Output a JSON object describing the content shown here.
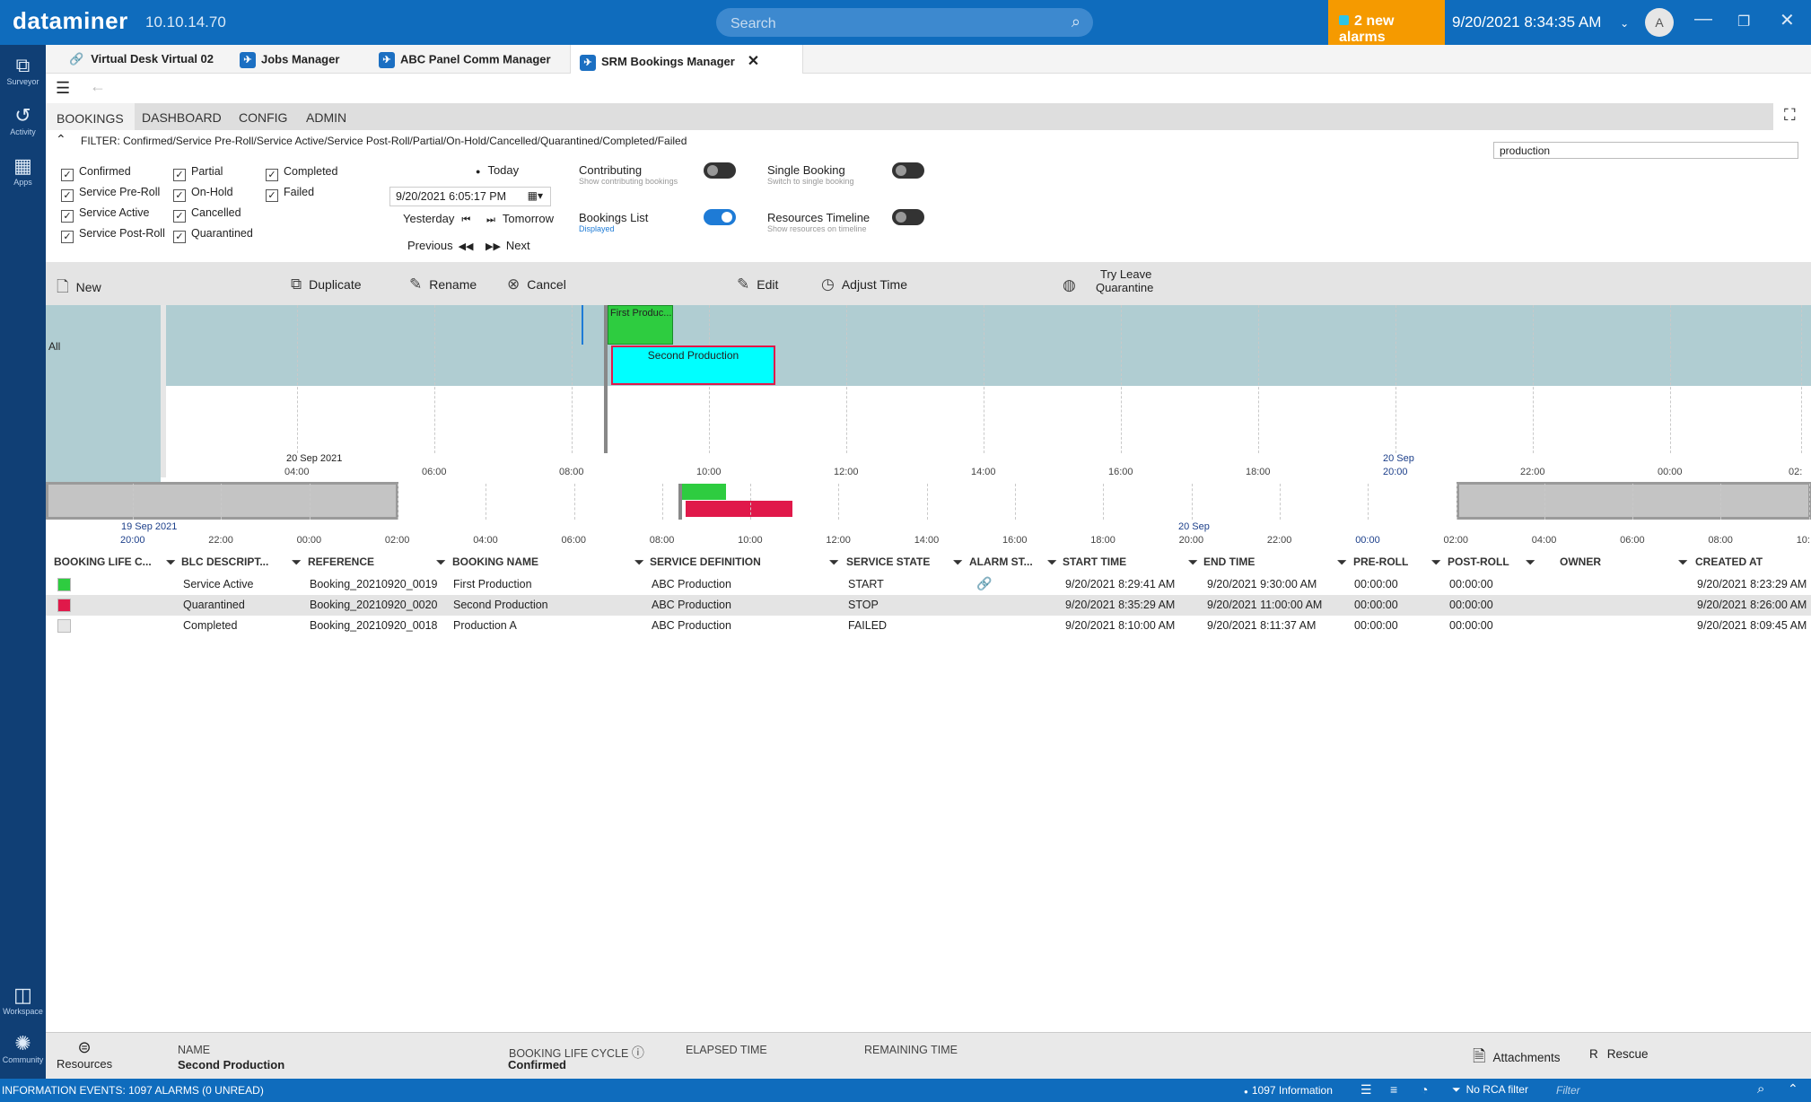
{
  "app": {
    "logo": "dataminer",
    "ip": "10.10.14.70",
    "search_placeholder": "Search",
    "alarms": "2 new alarms",
    "clock": "9/20/2021 8:34:35 AM",
    "avatar": "A"
  },
  "rail": [
    {
      "label": "Surveyor",
      "icon": "surveyor-icon"
    },
    {
      "label": "Activity",
      "icon": "activity-icon"
    },
    {
      "label": "Apps",
      "icon": "apps-icon"
    },
    {
      "label": "Workspace",
      "icon": "workspace-icon"
    },
    {
      "label": "Community",
      "icon": "community-icon"
    }
  ],
  "tabs": [
    {
      "label": "Virtual Desk Virtual 02"
    },
    {
      "label": "Jobs Manager"
    },
    {
      "label": "ABC Panel Comm Manager"
    },
    {
      "label": "SRM Bookings Manager"
    }
  ],
  "subtabs": [
    "BOOKINGS",
    "DASHBOARD",
    "CONFIG",
    "ADMIN"
  ],
  "filter": "FILTER: Confirmed/Service Pre-Roll/Service Active/Service Post-Roll/Partial/On-Hold/Cancelled/Quarantined/Completed/Failed",
  "search_value": "production",
  "checkboxes": {
    "col1": [
      "Confirmed",
      "Service Pre-Roll",
      "Service Active",
      "Service Post-Roll"
    ],
    "col2": [
      "Partial",
      "On-Hold",
      "Cancelled",
      "Quarantined"
    ],
    "col3": [
      "Completed",
      "Failed"
    ]
  },
  "nav": {
    "today": "Today",
    "date": "9/20/2021 6:05:17 PM",
    "yesterday": "Yesterday",
    "tomorrow": "Tomorrow",
    "previous": "Previous",
    "next": "Next"
  },
  "toggles": {
    "contributing": {
      "label": "Contributing",
      "sub": "Show contributing bookings",
      "on": false
    },
    "single": {
      "label": "Single Booking",
      "sub": "Switch to single booking",
      "on": false
    },
    "list": {
      "label": "Bookings List",
      "sub": "Displayed",
      "on": true
    },
    "resources": {
      "label": "Resources Timeline",
      "sub": "Show resources on timeline",
      "on": false
    }
  },
  "toolbar": {
    "new": "New",
    "duplicate": "Duplicate",
    "rename": "Rename",
    "cancel": "Cancel",
    "edit": "Edit",
    "adjust": "Adjust Time",
    "try1": "Try Leave",
    "try2": "Quarantine"
  },
  "timeline": {
    "row_label": "All",
    "first_booking": "First Produc...",
    "second_booking": "Second Production",
    "ticks": [
      "04:00",
      "06:00",
      "08:00",
      "10:00",
      "12:00",
      "14:00",
      "16:00",
      "18:00",
      "20:00",
      "22:00",
      "00:00",
      "02:"
    ],
    "day_label_1": "20 Sep 2021",
    "day_label_2": "20 Sep",
    "mini_ticks": [
      "20:00",
      "22:00",
      "00:00",
      "02:00",
      "04:00",
      "06:00",
      "08:00",
      "10:00",
      "12:00",
      "14:00",
      "16:00",
      "18:00",
      "20:00",
      "22:00",
      "00:00",
      "02:00",
      "04:00",
      "06:00",
      "08:00",
      "10:"
    ],
    "mini_day_1": "19 Sep 2021",
    "mini_day_2": "20 Sep"
  },
  "table": {
    "headers": [
      "BOOKING LIFE C...",
      "BLC DESCRIPT...",
      "REFERENCE",
      "BOOKING NAME",
      "SERVICE DEFINITION",
      "SERVICE STATE",
      "ALARM ST...",
      "START TIME",
      "END TIME",
      "PRE-ROLL",
      "POST-ROLL",
      "OWNER",
      "CREATED AT"
    ],
    "rows": [
      {
        "color": "#2ecc40",
        "blc": "Service Active",
        "ref": "Booking_20210920_0019",
        "name": "First Production",
        "sd": "ABC Production",
        "state": "START",
        "alarm": "link-icon",
        "start": "9/20/2021 8:29:41 AM",
        "end": "9/20/2021 9:30:00 AM",
        "pre": "00:00:00",
        "post": "00:00:00",
        "owner": "",
        "created": "9/20/2021 8:23:29 AM"
      },
      {
        "color": "#e0194a",
        "blc": "Quarantined",
        "ref": "Booking_20210920_0020",
        "name": "Second Production",
        "sd": "ABC Production",
        "state": "STOP",
        "alarm": "",
        "start": "9/20/2021 8:35:29 AM",
        "end": "9/20/2021 11:00:00 AM",
        "pre": "00:00:00",
        "post": "00:00:00",
        "owner": "",
        "created": "9/20/2021 8:26:00 AM"
      },
      {
        "color": "#e6e6e6",
        "blc": "Completed",
        "ref": "Booking_20210920_0018",
        "name": "Production A",
        "sd": "ABC Production",
        "state": "FAILED",
        "alarm": "",
        "start": "9/20/2021 8:10:00 AM",
        "end": "9/20/2021 8:11:37 AM",
        "pre": "00:00:00",
        "post": "00:00:00",
        "owner": "",
        "created": "9/20/2021 8:09:45 AM"
      }
    ]
  },
  "bottom": {
    "resources": "Resources",
    "name_label": "NAME",
    "name_value": "Second Production",
    "blc_label": "BOOKING LIFE CYCLE",
    "blc_value": "Confirmed",
    "elapsed": "ELAPSED TIME",
    "remaining": "REMAINING TIME",
    "attachments": "Attachments",
    "rescue": "Rescue"
  },
  "status": {
    "left": "INFORMATION EVENTS: 1097 ALARMS (0 UNREAD)",
    "info": "1097 Information",
    "rca": "No RCA filter",
    "filter_placeholder": "Filter"
  }
}
